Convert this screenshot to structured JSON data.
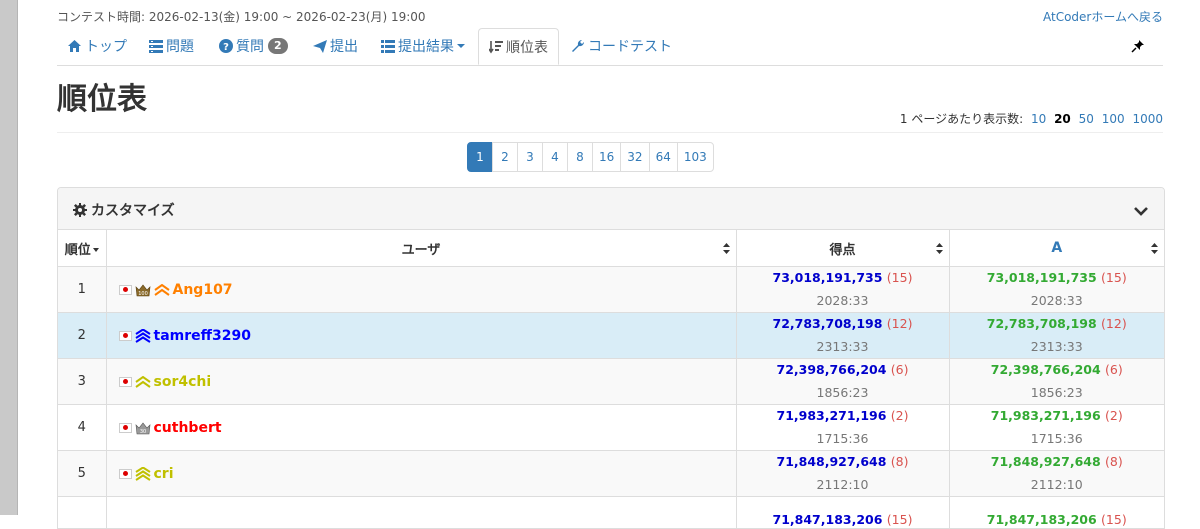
{
  "contest_time": "コンテスト時間: 2026-02-13(金) 19:00 ~ 2026-02-23(月) 19:00",
  "home_link": "AtCoderホームへ戻る",
  "nav": {
    "top": "トップ",
    "tasks": "問題",
    "questions": "質問",
    "questions_badge": "2",
    "submit": "提出",
    "results": "提出結果",
    "standings": "順位表",
    "custom_test": "コードテスト"
  },
  "page_title": "順位表",
  "per_page": {
    "label": "1 ページあたり表示数:",
    "options": [
      "10",
      "20",
      "50",
      "100",
      "1000"
    ],
    "selected": "20"
  },
  "pagination": [
    "1",
    "2",
    "3",
    "4",
    "8",
    "16",
    "32",
    "64",
    "103"
  ],
  "pagination_active": "1",
  "customize_label": "カスタマイズ",
  "table": {
    "headers": {
      "rank": "順位",
      "user": "ユーザ",
      "score": "得点",
      "task_a": "A"
    },
    "rows": [
      {
        "rank": "1",
        "user": "Ang107",
        "user_color": "#ff8000",
        "score": "73,018,191,735",
        "penalty": "(15)",
        "time": "2028:33",
        "a_score": "73,018,191,735",
        "a_penalty": "(15)",
        "a_time": "2028:33",
        "crown": "100"
      },
      {
        "rank": "2",
        "user": "tamreff3290",
        "user_color": "#0000ff",
        "score": "72,783,708,198",
        "penalty": "(12)",
        "time": "2313:33",
        "a_score": "72,783,708,198",
        "a_penalty": "(12)",
        "a_time": "2313:33",
        "crown": ""
      },
      {
        "rank": "3",
        "user": "sor4chi",
        "user_color": "#c0c000",
        "score": "72,398,766,204",
        "penalty": "(6)",
        "time": "1856:23",
        "a_score": "72,398,766,204",
        "a_penalty": "(6)",
        "a_time": "1856:23",
        "crown": ""
      },
      {
        "rank": "4",
        "user": "cuthbert",
        "user_color": "#ff0000",
        "score": "71,983,271,196",
        "penalty": "(2)",
        "time": "1715:36",
        "a_score": "71,983,271,196",
        "a_penalty": "(2)",
        "a_time": "1715:36",
        "crown": "30"
      },
      {
        "rank": "5",
        "user": "cri",
        "user_color": "#c0c000",
        "score": "71,848,927,648",
        "penalty": "(8)",
        "time": "2112:10",
        "a_score": "71,848,927,648",
        "a_penalty": "(8)",
        "a_time": "2112:10",
        "crown": ""
      },
      {
        "rank": "",
        "user": "",
        "user_color": "#333333",
        "score": "71,847,183,206",
        "penalty": "(15)",
        "time": "",
        "a_score": "71,847,183,206",
        "a_penalty": "(15)",
        "a_time": "",
        "crown": ""
      }
    ]
  },
  "colors": {
    "link": "#337ab7",
    "score_blue": "#0000cc",
    "score_green": "#33aa33",
    "penalty_red": "#d9534f",
    "active_page": "#337ab7",
    "highlight_row": "#d9edf7"
  }
}
